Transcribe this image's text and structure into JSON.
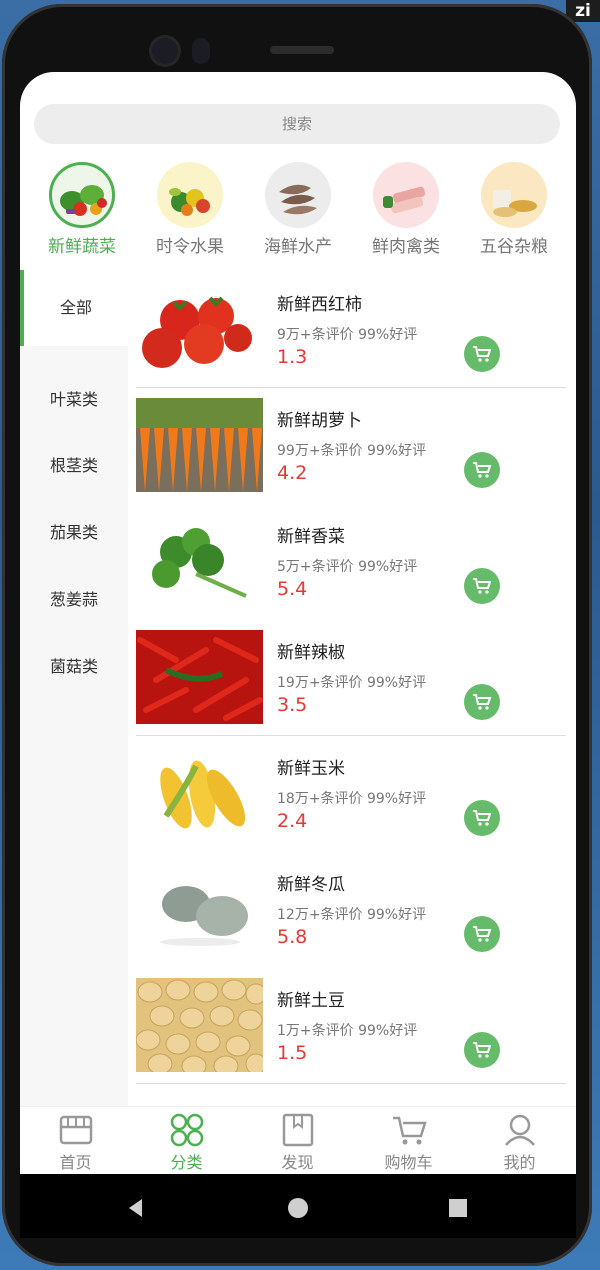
{
  "app": {
    "search_placeholder": "搜索"
  },
  "categories": [
    {
      "label": "新鲜蔬菜",
      "active": true
    },
    {
      "label": "时令水果",
      "active": false
    },
    {
      "label": "海鲜水产",
      "active": false
    },
    {
      "label": "鲜肉禽类",
      "active": false
    },
    {
      "label": "五谷杂粮",
      "active": false
    }
  ],
  "sidebar": {
    "items": [
      {
        "label": "全部"
      },
      {
        "label": "叶菜类"
      },
      {
        "label": "根茎类"
      },
      {
        "label": "茄果类"
      },
      {
        "label": "葱姜蒜"
      },
      {
        "label": "菌菇类"
      }
    ]
  },
  "products": [
    {
      "name": "新鲜西红柿",
      "meta": "9万+条评价 99%好评",
      "price": "1.3"
    },
    {
      "name": "新鲜胡萝卜",
      "meta": "99万+条评价 99%好评",
      "price": "4.2"
    },
    {
      "name": "新鲜香菜",
      "meta": "5万+条评价 99%好评",
      "price": "5.4"
    },
    {
      "name": "新鲜辣椒",
      "meta": "19万+条评价 99%好评",
      "price": "3.5"
    },
    {
      "name": "新鲜玉米",
      "meta": "18万+条评价 99%好评",
      "price": "2.4"
    },
    {
      "name": "新鲜冬瓜",
      "meta": "12万+条评价 99%好评",
      "price": "5.8"
    },
    {
      "name": "新鲜土豆",
      "meta": "1万+条评价 99%好评",
      "price": "1.5"
    }
  ],
  "tabbar": {
    "items": [
      {
        "label": "首页",
        "icon": "store-icon"
      },
      {
        "label": "分类",
        "icon": "grid-icon"
      },
      {
        "label": "发现",
        "icon": "bookmark-icon"
      },
      {
        "label": "购物车",
        "icon": "cart-icon"
      },
      {
        "label": "我的",
        "icon": "user-icon"
      }
    ]
  },
  "colors": {
    "accent": "#4caf50",
    "price": "#e53935"
  }
}
